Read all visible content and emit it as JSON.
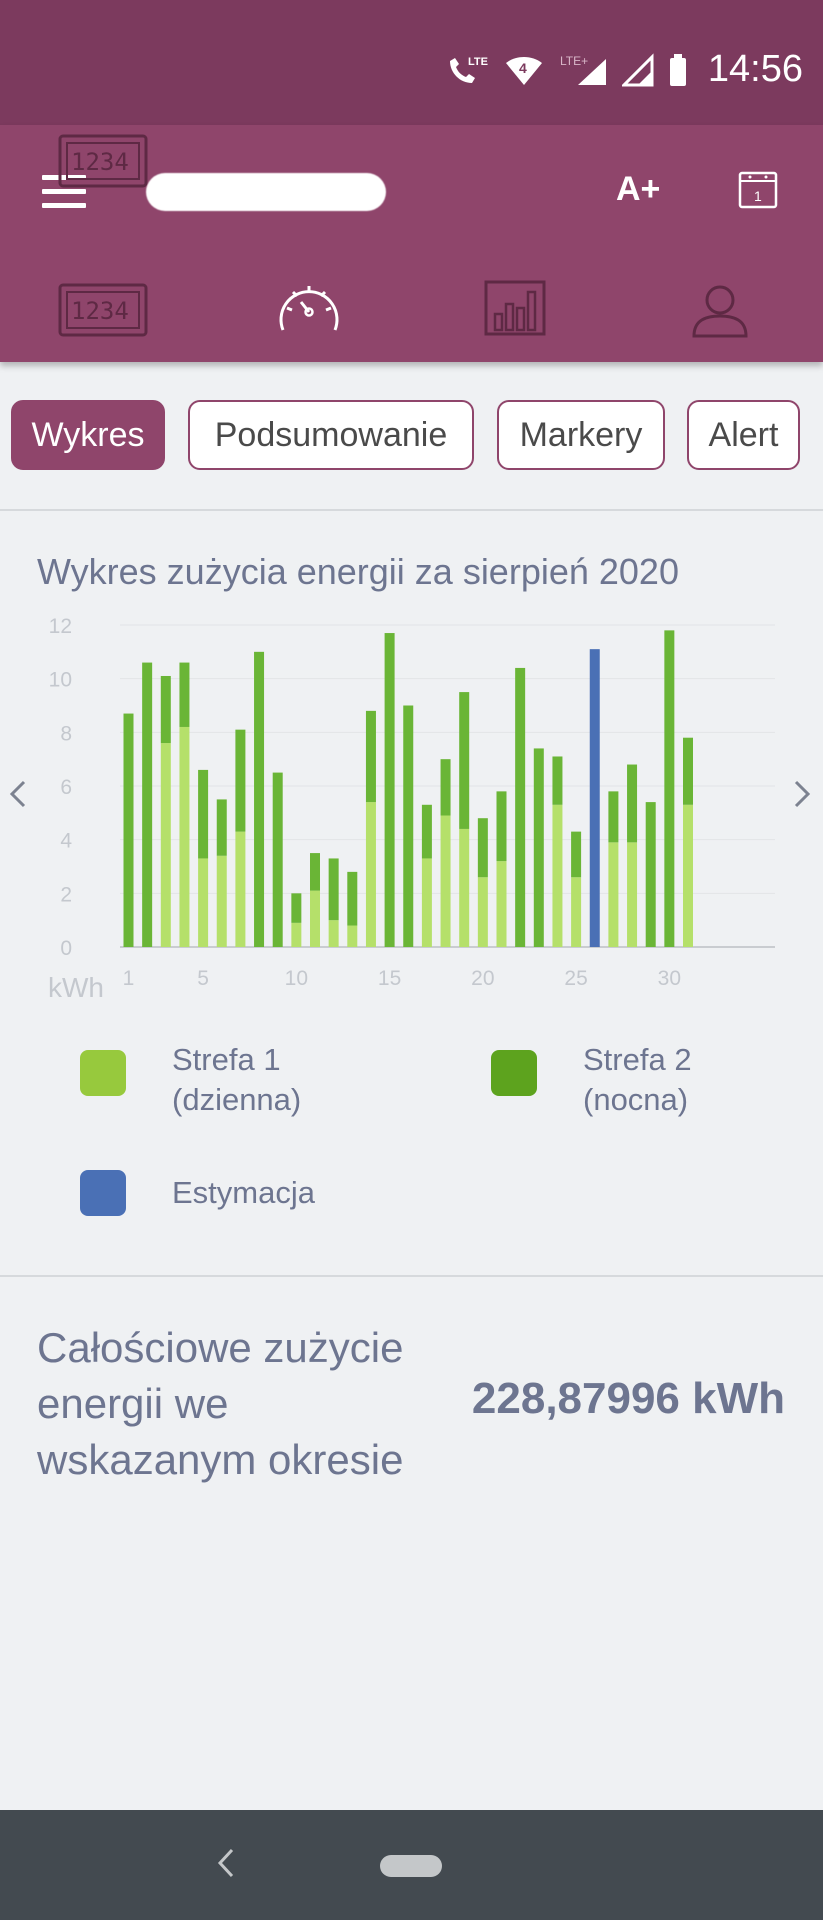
{
  "status_bar": {
    "time": "14:56",
    "lte_label": "LTE",
    "lte_plus_label": "LTE+"
  },
  "app_bar": {
    "font_button": "A+",
    "calendar_day": "1",
    "nav_meter_digits": "1234"
  },
  "tabs": [
    {
      "label": "Wykres",
      "active": true
    },
    {
      "label": "Podsumowanie",
      "active": false
    },
    {
      "label": "Markery",
      "active": false
    },
    {
      "label": "Alert",
      "active": false
    }
  ],
  "chart_data": {
    "type": "bar",
    "title": "Wykres zużycia energii za sierpień 2020",
    "ylabel": "kWh",
    "ylim": [
      0,
      12
    ],
    "yticks": [
      0,
      2,
      4,
      6,
      8,
      10,
      12
    ],
    "xticks": [
      1,
      5,
      10,
      15,
      20,
      25,
      30
    ],
    "x": [
      1,
      2,
      3,
      4,
      5,
      6,
      7,
      8,
      9,
      10,
      11,
      12,
      13,
      14,
      15,
      16,
      17,
      18,
      19,
      20,
      21,
      22,
      23,
      24,
      25,
      26,
      27,
      28,
      29,
      30,
      31
    ],
    "stacked": true,
    "series": [
      {
        "name": "Strefa 1 (dzienna)",
        "color": "#b5e06a",
        "values": [
          0,
          0,
          7.6,
          8.2,
          3.3,
          3.4,
          4.3,
          0,
          0,
          0.9,
          2.1,
          1.0,
          0.8,
          5.4,
          0,
          0,
          3.3,
          4.9,
          4.4,
          2.6,
          3.2,
          0,
          0,
          5.3,
          2.6,
          0,
          3.9,
          3.9,
          0,
          0,
          5.3
        ]
      },
      {
        "name": "Strefa 2 (nocna)",
        "color": "#6ab536",
        "values": [
          8.7,
          10.6,
          2.5,
          2.4,
          3.3,
          2.1,
          3.8,
          11.0,
          6.5,
          1.1,
          1.4,
          2.3,
          2.0,
          3.4,
          11.7,
          9.0,
          2.0,
          2.1,
          5.1,
          2.2,
          2.6,
          10.4,
          7.4,
          1.8,
          1.7,
          0,
          1.9,
          2.9,
          5.4,
          11.8,
          2.5
        ]
      },
      {
        "name": "Estymacja",
        "color": "#4a70b5",
        "values": [
          0,
          0,
          0,
          0,
          0,
          0,
          0,
          0,
          0,
          0,
          0,
          0,
          0,
          0,
          0,
          0,
          0,
          0,
          0,
          0,
          0,
          0,
          0,
          0,
          0,
          11.1,
          0,
          0,
          0,
          0,
          0
        ]
      }
    ]
  },
  "legend": [
    {
      "line1": "Strefa 1",
      "line2": "(dzienna)",
      "color": "#97c93d"
    },
    {
      "line1": "Strefa 2",
      "line2": "(nocna)",
      "color": "#5da31e"
    },
    {
      "line1": "Estymacja",
      "line2": "",
      "color": "#4a70b5"
    }
  ],
  "summary": {
    "label": "Całościowe zużycie energii we wskazanym okresie",
    "value": "228,87996 kWh"
  }
}
